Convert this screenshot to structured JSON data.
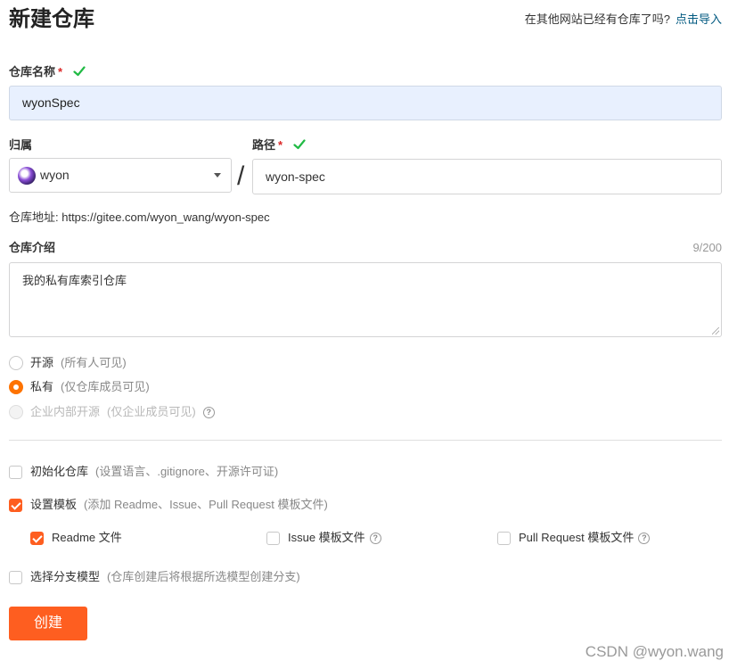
{
  "header": {
    "title": "新建仓库",
    "import_prompt": "在其他网站已经有仓库了吗?",
    "import_link": "点击导入"
  },
  "repo_name": {
    "label": "仓库名称",
    "required_mark": "*",
    "value": "wyonSpec",
    "valid_icon": "check-icon"
  },
  "owner": {
    "label": "归属",
    "value": "wyon",
    "avatar_icon": "avatar"
  },
  "path": {
    "label": "路径",
    "required_mark": "*",
    "separator": "/",
    "value": "wyon-spec",
    "valid_icon": "check-icon"
  },
  "address": {
    "text": "仓库地址: https://gitee.com/wyon_wang/wyon-spec"
  },
  "description": {
    "label": "仓库介绍",
    "counter": "9/200",
    "value": "我的私有库索引仓库"
  },
  "visibility": {
    "options": [
      {
        "label": "开源",
        "hint": "(所有人可见)",
        "selected": false,
        "disabled": false
      },
      {
        "label": "私有",
        "hint": "(仅仓库成员可见)",
        "selected": true,
        "disabled": false
      },
      {
        "label": "企业内部开源",
        "hint": "(仅企业成员可见)",
        "selected": false,
        "disabled": true
      }
    ],
    "help_glyph": "?"
  },
  "options": {
    "init": {
      "label": "初始化仓库",
      "hint": "(设置语言、.gitignore、开源许可证)",
      "checked": false
    },
    "template": {
      "label": "设置模板",
      "hint": "(添加 Readme、Issue、Pull Request 模板文件)",
      "checked": true
    },
    "template_items": [
      {
        "label": "Readme 文件",
        "checked": true,
        "help": false
      },
      {
        "label": "Issue 模板文件",
        "checked": false,
        "help": true
      },
      {
        "label": "Pull Request 模板文件",
        "checked": false,
        "help": true
      }
    ],
    "branch_model": {
      "label": "选择分支模型",
      "hint": "(仓库创建后将根据所选模型创建分支)",
      "checked": false
    }
  },
  "actions": {
    "create_label": "创建"
  },
  "watermark": "CSDN @wyon.wang",
  "colors": {
    "accent": "#fe5e20",
    "radio_accent": "#fe7300",
    "valid": "#21ba45",
    "link": "#005980"
  }
}
